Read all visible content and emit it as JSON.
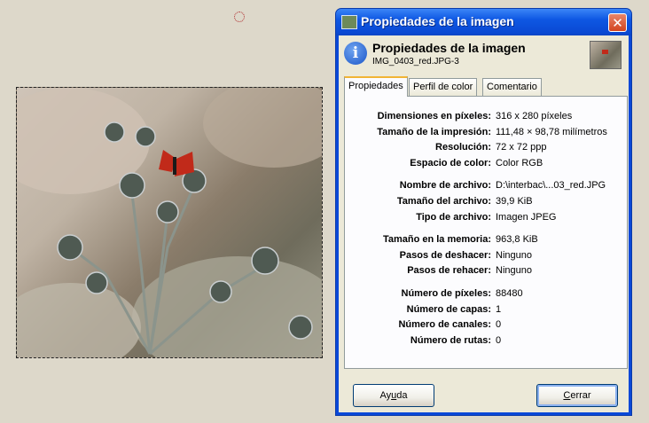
{
  "dialog": {
    "window_title": "Propiedades de la imagen",
    "close_glyph": "✕",
    "header_title": "Propiedades de la imagen",
    "header_subtitle": "IMG_0403_red.JPG-3",
    "tabs": [
      {
        "label": "Propiedades",
        "active": true
      },
      {
        "label": "Perfil de color",
        "active": false
      },
      {
        "label": "Comentario",
        "active": false
      }
    ],
    "groups": [
      [
        {
          "label": "Dimensiones en píxeles:",
          "value": "316 x 280 píxeles"
        },
        {
          "label": "Tamaño de la impresión:",
          "value": "111,48 × 98,78 milímetros"
        },
        {
          "label": "Resolución:",
          "value": "72 x 72 ppp"
        },
        {
          "label": "Espacio de color:",
          "value": "Color RGB"
        }
      ],
      [
        {
          "label": "Nombre de archivo:",
          "value": "D:\\interbac\\...03_red.JPG"
        },
        {
          "label": "Tamaño del archivo:",
          "value": "39,9 KiB"
        },
        {
          "label": "Tipo de archivo:",
          "value": "Imagen JPEG"
        }
      ],
      [
        {
          "label": "Tamaño en la memoria:",
          "value": "963,8 KiB"
        },
        {
          "label": "Pasos de deshacer:",
          "value": "Ninguno"
        },
        {
          "label": "Pasos de rehacer:",
          "value": "Ninguno"
        }
      ],
      [
        {
          "label": "Número de píxeles:",
          "value": "88480"
        },
        {
          "label": "Número de capas:",
          "value": "1"
        },
        {
          "label": "Número de canales:",
          "value": "0"
        },
        {
          "label": "Número de rutas:",
          "value": "0"
        }
      ]
    ],
    "help_button": {
      "pre": "Ay",
      "mnemonic": "u",
      "post": "da"
    },
    "close_button": {
      "pre": "",
      "mnemonic": "C",
      "post": "errar"
    }
  },
  "colors": {
    "titlebar": "#0a49d3",
    "face": "#ece9d8",
    "tab_accent": "#f1b435",
    "butterfly": "#c12a1a"
  },
  "icons": {
    "title": "image-icon",
    "header": "info-icon",
    "thumbnail": "image-thumbnail"
  }
}
